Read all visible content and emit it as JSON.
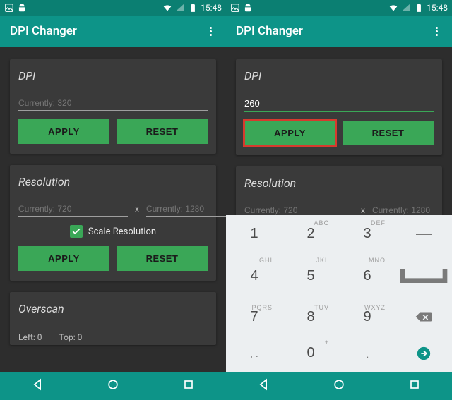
{
  "status": {
    "time": "15:48"
  },
  "app": {
    "title": "DPI Changer"
  },
  "left": {
    "dpi": {
      "title": "DPI",
      "placeholder": "Currently: 320",
      "apply": "APPLY",
      "reset": "RESET"
    },
    "res": {
      "title": "Resolution",
      "w_placeholder": "Currently: 720",
      "h_placeholder": "Currently: 1280",
      "times": "x",
      "scale_label": "Scale Resolution",
      "apply": "APPLY",
      "reset": "RESET"
    },
    "overscan": {
      "title": "Overscan",
      "left_label": "Left: 0",
      "top_label": "Top: 0"
    }
  },
  "right": {
    "dpi": {
      "title": "DPI",
      "value": "260",
      "apply": "APPLY",
      "reset": "RESET"
    },
    "res": {
      "title": "Resolution",
      "w_placeholder": "Currently: 720",
      "h_placeholder": "Currently: 1280",
      "times": "x"
    }
  },
  "keypad": {
    "k1": "1",
    "k2": "2",
    "k3": "3",
    "k4": "4",
    "k5": "5",
    "k6": "6",
    "k7": "7",
    "k8": "8",
    "k9": "9",
    "k0": "0",
    "sub2": "ABC",
    "sub3": "DEF",
    "sub4": "GHI",
    "sub5": "JKL",
    "sub6": "MNO",
    "sub7": "PQRS",
    "sub8": "TUV",
    "sub9": "WXYZ",
    "sub0": "+",
    "dash": "—",
    "comma": ", .",
    "dot": "."
  }
}
